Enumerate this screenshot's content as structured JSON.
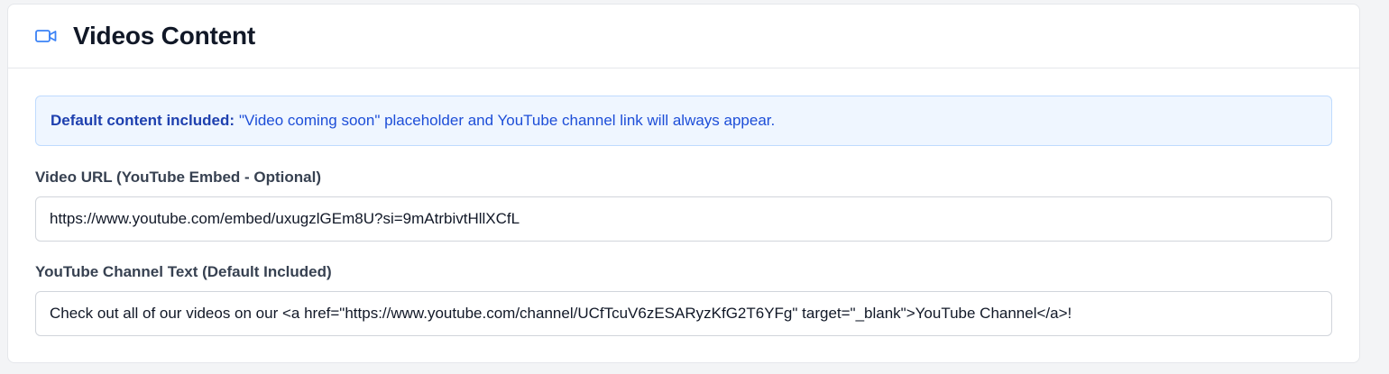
{
  "card": {
    "title": "Videos Content",
    "icon": "video-camera-icon",
    "accent_color": "#3b82f6"
  },
  "notice": {
    "strong_text": "Default content included:",
    "text": "\"Video coming soon\" placeholder and YouTube channel link will always appear."
  },
  "fields": {
    "video_url": {
      "label": "Video URL (YouTube Embed - Optional)",
      "value": "https://www.youtube.com/embed/uxugzlGEm8U?si=9mAtrbivtHllXCfL"
    },
    "channel_text": {
      "label": "YouTube Channel Text (Default Included)",
      "value": "Check out all of our videos on our <a href=\"https://www.youtube.com/channel/UCfTcuV6zESARyzKfG2T6YFg\" target=\"_blank\">YouTube Channel</a>!"
    }
  }
}
